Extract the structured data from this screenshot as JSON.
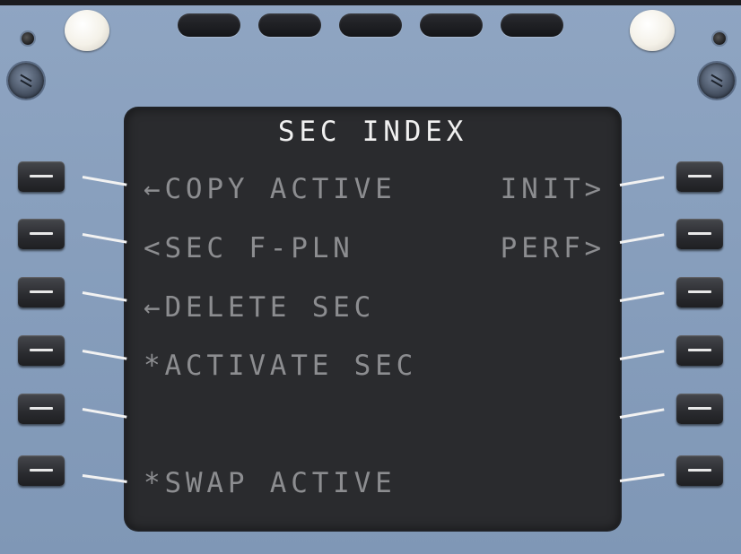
{
  "mcdu": {
    "title": "SEC INDEX",
    "left_lines": [
      "←COPY ACTIVE",
      "<SEC F-PLN",
      "←DELETE SEC",
      "*ACTIVATE SEC",
      "",
      "*SWAP ACTIVE"
    ],
    "right_lines": [
      "INIT>",
      "PERF>",
      "",
      "",
      "",
      ""
    ],
    "colors": {
      "title": "#f0f0f0",
      "inactive_text": "#8c8d90",
      "screen": "#2a2b2e",
      "bezel": "#8fa5c2"
    },
    "icons": {
      "line_select_key": "dash-icon",
      "annunciator_lamp": "lamp-icon",
      "mounting_screw": "screw-icon"
    }
  }
}
